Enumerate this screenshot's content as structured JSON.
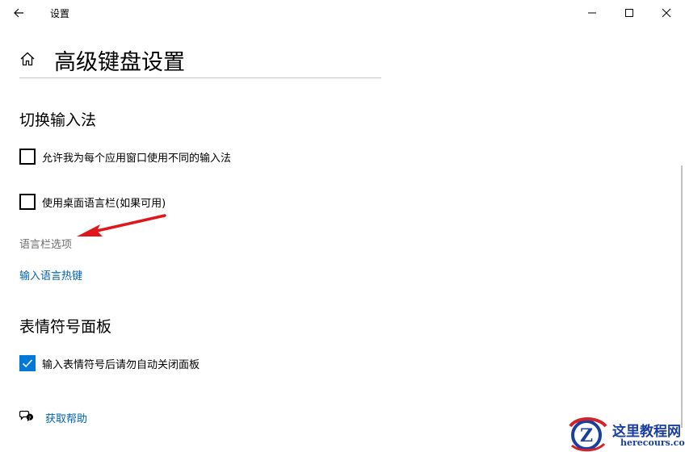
{
  "window": {
    "title": "设置",
    "back_icon": "back-arrow-icon",
    "minimize_icon": "minimize-icon",
    "maximize_icon": "maximize-icon",
    "close_icon": "close-icon"
  },
  "header": {
    "home_icon": "home-icon",
    "title": "高级键盘设置"
  },
  "switch_input": {
    "heading": "切换输入法",
    "options": [
      {
        "label": "允许我为每个应用窗口使用不同的输入法",
        "checked": false
      },
      {
        "label": "使用桌面语言栏(如果可用)",
        "checked": false
      }
    ],
    "language_bar_options": "语言栏选项",
    "hotkeys_link": "输入语言热键"
  },
  "emoji_panel": {
    "heading": "表情符号面板",
    "options": [
      {
        "label": "输入表情符号后请勿自动关闭面板",
        "checked": true
      }
    ]
  },
  "help": {
    "icon": "chat-help-icon",
    "label": "获取帮助"
  },
  "annotation": {
    "arrow_color": "#e0161b"
  },
  "watermark": {
    "text_main": "这里教程网",
    "text_sub": "herecours.com",
    "logo_letter": "Z"
  },
  "colors": {
    "accent": "#0078d7",
    "link": "#0063b1",
    "disabled": "#6d6d6d"
  }
}
